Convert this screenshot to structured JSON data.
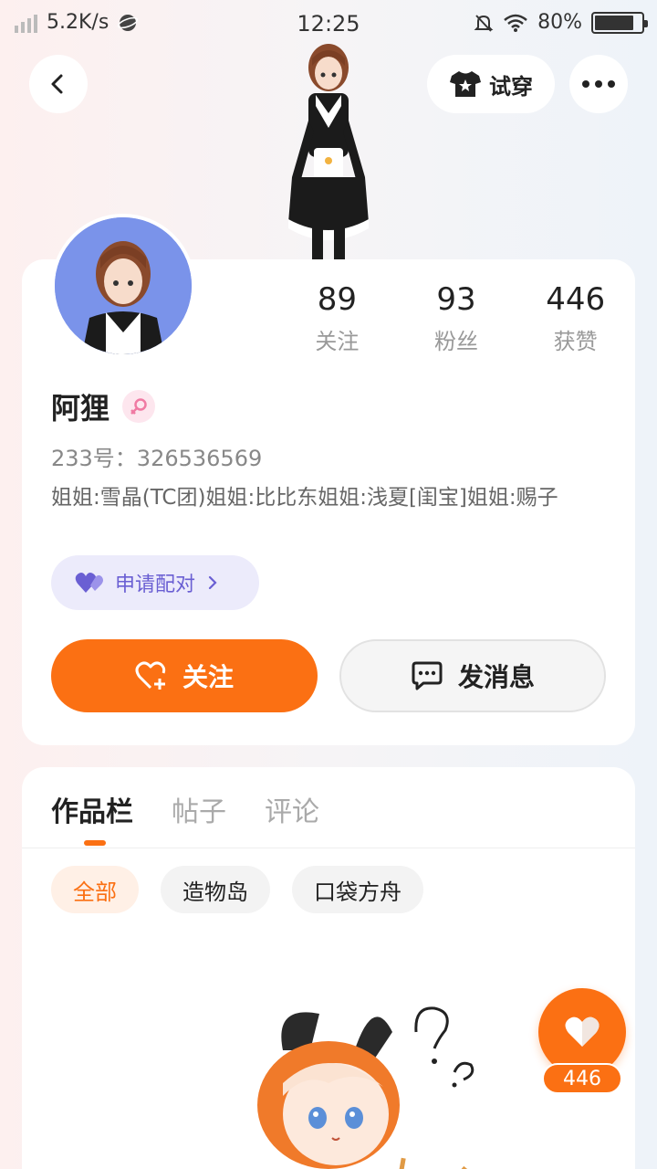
{
  "status_bar": {
    "network_speed": "5.2K/s",
    "time": "12:25",
    "battery": "80%"
  },
  "header": {
    "tryon_label": "试穿"
  },
  "profile": {
    "name": "阿狸",
    "uid": "233号：326536569",
    "bio": "姐姐:雪晶(TC团)姐姐:比比东姐姐:浅夏[闺宝]姐姐:赐子",
    "stats": [
      {
        "value": "89",
        "label": "关注"
      },
      {
        "value": "93",
        "label": "粉丝"
      },
      {
        "value": "446",
        "label": "获赞"
      }
    ],
    "pair_label": "申请配对",
    "follow_label": "关注",
    "message_label": "发消息"
  },
  "works": {
    "tabs": [
      "作品栏",
      "帖子",
      "评论"
    ],
    "active_tab": 0,
    "chips": [
      "全部",
      "造物岛",
      "口袋方舟"
    ],
    "active_chip": 0
  },
  "like": {
    "count": "446"
  },
  "colors": {
    "accent": "#fb7013",
    "pair": "#6a5fd3"
  }
}
